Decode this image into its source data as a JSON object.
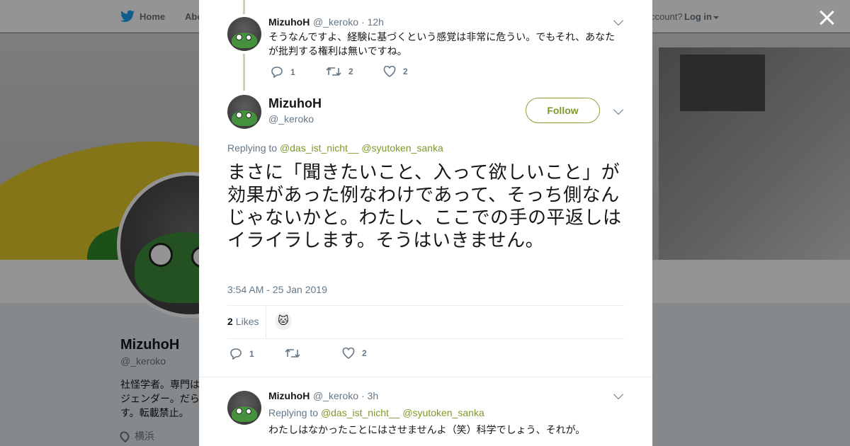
{
  "topnav": {
    "home_label": "Home",
    "about_label": "Abo",
    "account_text": "ccount?",
    "login_label": "Log in"
  },
  "profile": {
    "name": "MizuhoH",
    "handle": "@_keroko",
    "bio_lines": [
      "社怪学者。専門は",
      "ジェンダー。だら",
      "す。転載禁止。"
    ],
    "location": "横浜"
  },
  "tweets": {
    "prev": {
      "name": "MizuhoH",
      "handle": "@_keroko",
      "time": "· 12h",
      "text": "そうなんですよ、経験に基づくという感覚は非常に危うい。でもそれ、あなたが批判する権利は無いですね。",
      "replies": "1",
      "retweets": "2",
      "likes": "2"
    },
    "main": {
      "name": "MizuhoH",
      "handle": "@_keroko",
      "follow_label": "Follow",
      "replying_to_label": "Replying to",
      "mention1": "@das_ist_nicht__",
      "mention2": "@syutoken_sanka",
      "text": "まさに「聞きたいこと、入って欲しいこと」が効果があった例なわけであって、そっち側なんじゃないかと。わたし、ここでの手の平返しはイライラします。そうはいきません。",
      "timestamp": "3:54 AM - 25 Jan 2019",
      "likes_count": "2",
      "likes_label": "Likes",
      "replies": "1",
      "likes": "2"
    },
    "next": {
      "name": "MizuhoH",
      "handle": "@_keroko",
      "time": "· 3h",
      "replying_to_label": "Replying to",
      "mention1": "@das_ist_nicht__",
      "mention2": "@syutoken_sanka",
      "text": "わたしはなかったことにはさせませんよ（笑）科学でしょう、それが。"
    }
  },
  "colors": {
    "accent": "#7c9a2a",
    "thread_line": "#c9d7a8",
    "muted": "#657786"
  }
}
